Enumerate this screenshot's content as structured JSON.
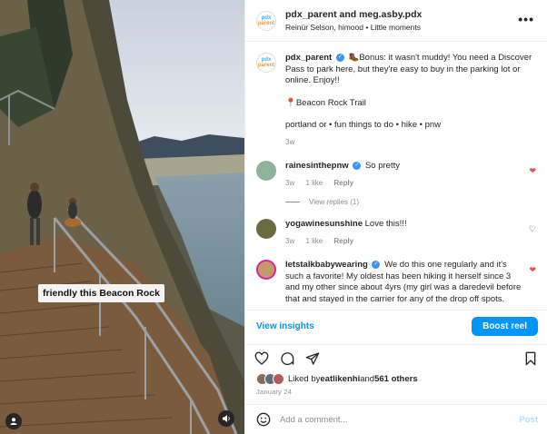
{
  "media": {
    "caption_overlay": "friendly this Beacon Rock"
  },
  "header": {
    "names": "pdx_parent and meg.asby.pdx",
    "subtitle": "Reinür Selson, himood • Little moments",
    "more_icon": "more-horizontal-icon"
  },
  "post_caption": {
    "user": "pdx_parent",
    "text1": "🥾Bonus: it wasn't muddy! You need a Discover Pass to park here, but they're easy to buy in the parking lot or online. Enjoy!!",
    "location": "📍Beacon Rock Trail",
    "tags": "portland or • fun things to do • hike • pnw",
    "time": "3w"
  },
  "comments": [
    {
      "user": "rainesinthepnw",
      "verified": true,
      "text": "So pretty",
      "time": "3w",
      "likes": "1 like",
      "reply": "Reply",
      "liked": true,
      "avatar_color": "#8fb39a"
    },
    {
      "user": "yogawinesunshine",
      "verified": false,
      "text": "Love this!!!",
      "time": "3w",
      "likes": "1 like",
      "reply": "Reply",
      "liked": false,
      "avatar_color": "#6b6b40"
    },
    {
      "user": "letstalkbabywearing",
      "verified": true,
      "text": "We do this one regularly and it's such a favorite! My oldest has been hiking it herself since 3 and my other since about 4yrs (my girl was a daredevil before that and stayed in the carrier for any of the drop off spots.",
      "time": "",
      "likes": "",
      "reply": "",
      "liked": true,
      "avatar_color": "#c49a6c"
    }
  ],
  "view_replies": "View replies (1)",
  "insights": {
    "label": "View insights",
    "boost": "Boost reel"
  },
  "likes": {
    "text_prefix": "Liked by ",
    "user": "eatlikenhi",
    "text_mid": " and ",
    "count": "561 others"
  },
  "date": "January 24",
  "add_comment": {
    "placeholder": "Add a comment...",
    "post": "Post"
  },
  "colors": {
    "accent": "#0095f6",
    "heart": "#ed4956",
    "verified": "#3797f0"
  }
}
